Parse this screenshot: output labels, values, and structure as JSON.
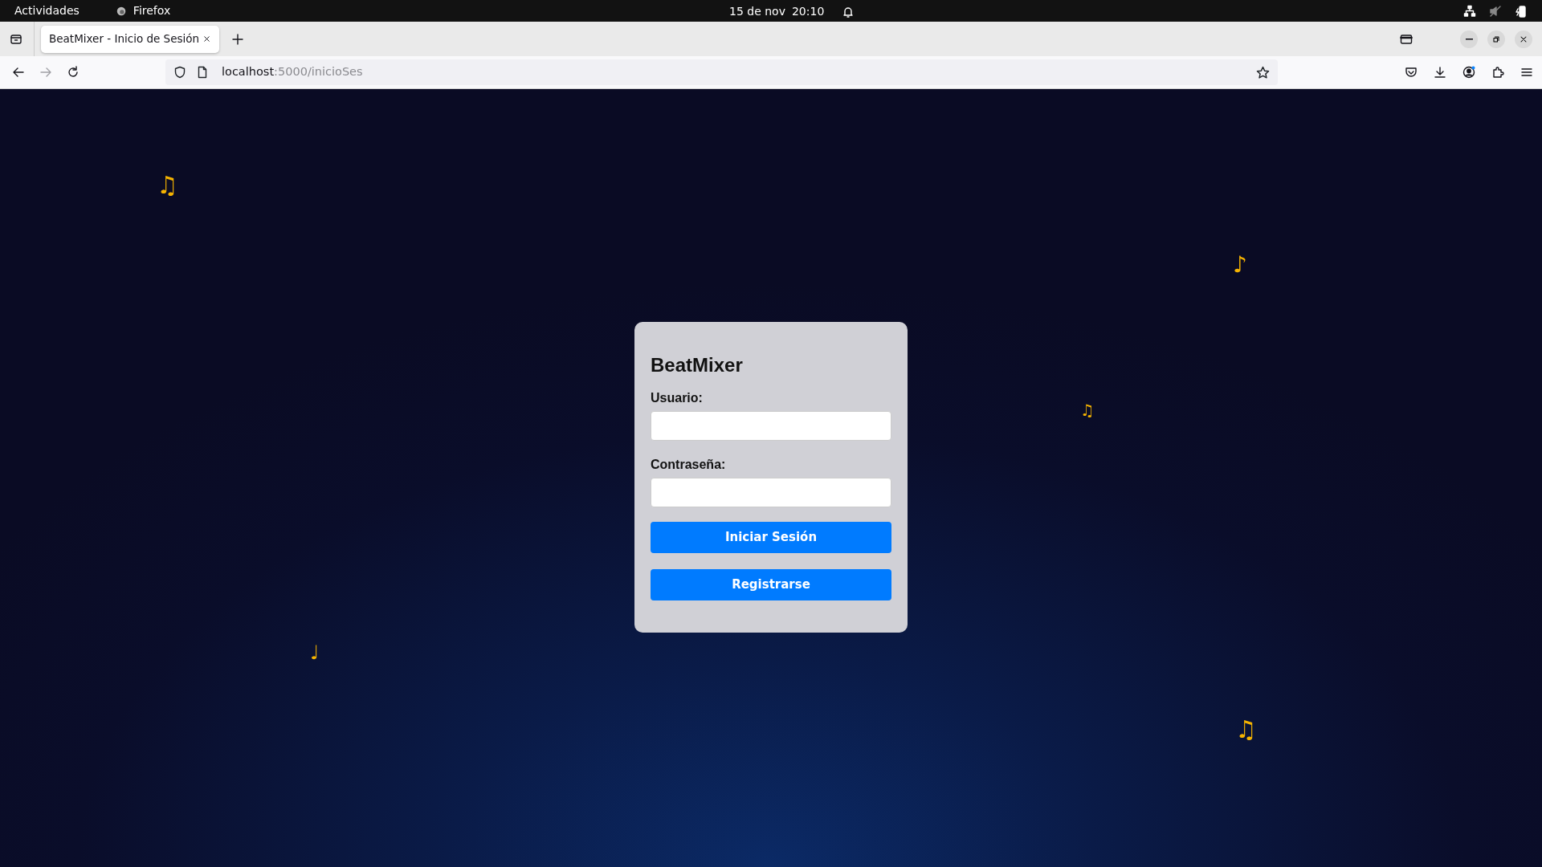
{
  "system_bar": {
    "activities": "Actividades",
    "app": "Firefox",
    "date": "15 de nov",
    "time": "20:10"
  },
  "browser": {
    "tabs": [
      {
        "title": "BeatMixer - Inicio de Sesión",
        "selected": true
      }
    ],
    "url_host": "localhost",
    "url_path": ":5000/inicioSes",
    "forward_disabled": true
  },
  "notes": [
    {
      "glyph": "♫"
    },
    {
      "glyph": "♪"
    },
    {
      "glyph": "♫"
    },
    {
      "glyph": "♩"
    },
    {
      "glyph": "♫"
    }
  ],
  "login": {
    "title": "BeatMixer",
    "fields": [
      {
        "label": "Usuario:"
      },
      {
        "label": "Contraseña:"
      }
    ],
    "buttons": [
      "Iniciar Sesión",
      "Registrarse"
    ]
  }
}
